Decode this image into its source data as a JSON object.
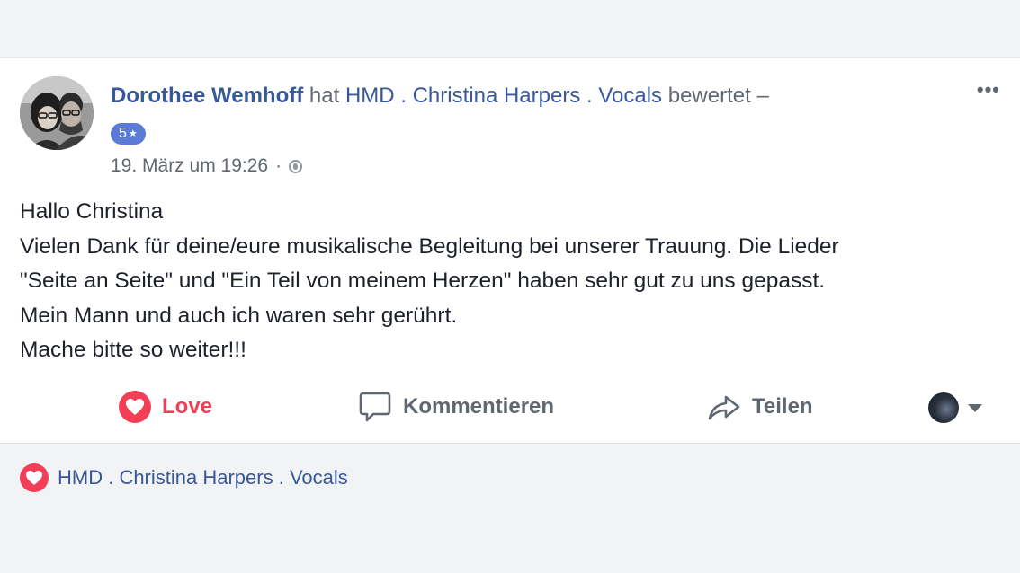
{
  "post": {
    "author": "Dorothee Wemhoff",
    "action_prefix": "hat",
    "page_name": "HMD . Christina Harpers . Vocals",
    "action_suffix": "bewertet –",
    "rating_value": "5",
    "rating_star": "★",
    "timestamp": "19. März um 19:26",
    "separator": "·",
    "text_lines": [
      "Hallo Christina",
      "Vielen Dank für deine/eure musikalische Begleitung bei unserer Trauung. Die Lieder",
      "\"Seite an Seite\" und \"Ein Teil von meinem Herzen\" haben sehr gut zu uns gepasst.",
      "Mein Mann und auch ich waren sehr gerührt.",
      "Mache bitte so weiter!!!"
    ],
    "more_label": "•••"
  },
  "actions": {
    "love_label": "Love",
    "comment_label": "Kommentieren",
    "share_label": "Teilen"
  },
  "reactions": {
    "reactor_name": "HMD . Christina Harpers . Vocals"
  },
  "colors": {
    "link": "#385898",
    "love": "#f33e58",
    "rating_badge": "#5b7bd5",
    "muted": "#606770",
    "background": "#f2f3f5"
  },
  "icons": {
    "love": "heart-icon",
    "comment": "speech-bubble-icon",
    "share": "share-arrow-icon",
    "privacy": "globe-icon",
    "menu": "more-options-icon",
    "dropdown": "chevron-down-icon"
  }
}
